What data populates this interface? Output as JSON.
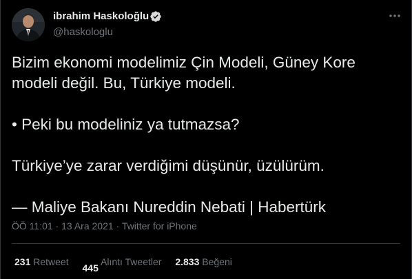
{
  "author": {
    "name": "ibrahim Haskoloğlu",
    "handle": "@haskologlu"
  },
  "tweet": {
    "lines": [
      "Bizim ekonomi modelimiz Çin Modeli, Güney Kore",
      "modeli değil. Bu, Türkiye modeli.",
      "",
      "• Peki bu modeliniz ya tutmazsa?",
      "",
      "Türkiye’ye zarar verdiğimi düşünür, üzülürüm.",
      "",
      "— Maliye Bakanı Nureddin Nebati | Habertürk"
    ]
  },
  "meta": {
    "time": "ÖÖ 11:01",
    "sep1": " · ",
    "date": "13 Ara 2021",
    "sep2": " · ",
    "source": "Twitter for iPhone"
  },
  "stats": {
    "retweets": {
      "count": "231",
      "label": "Retweet"
    },
    "quotes": {
      "count": "445",
      "label": "Alıntı Tweetler"
    },
    "likes": {
      "count": "2.833",
      "label": "Beğeni"
    }
  },
  "icons": {
    "verified": "verified-badge-icon",
    "more": "more-options-icon"
  },
  "colors": {
    "background": "#000000",
    "text": "#e7e9ea",
    "muted": "#71767b",
    "verified": "#d9d9d9"
  }
}
